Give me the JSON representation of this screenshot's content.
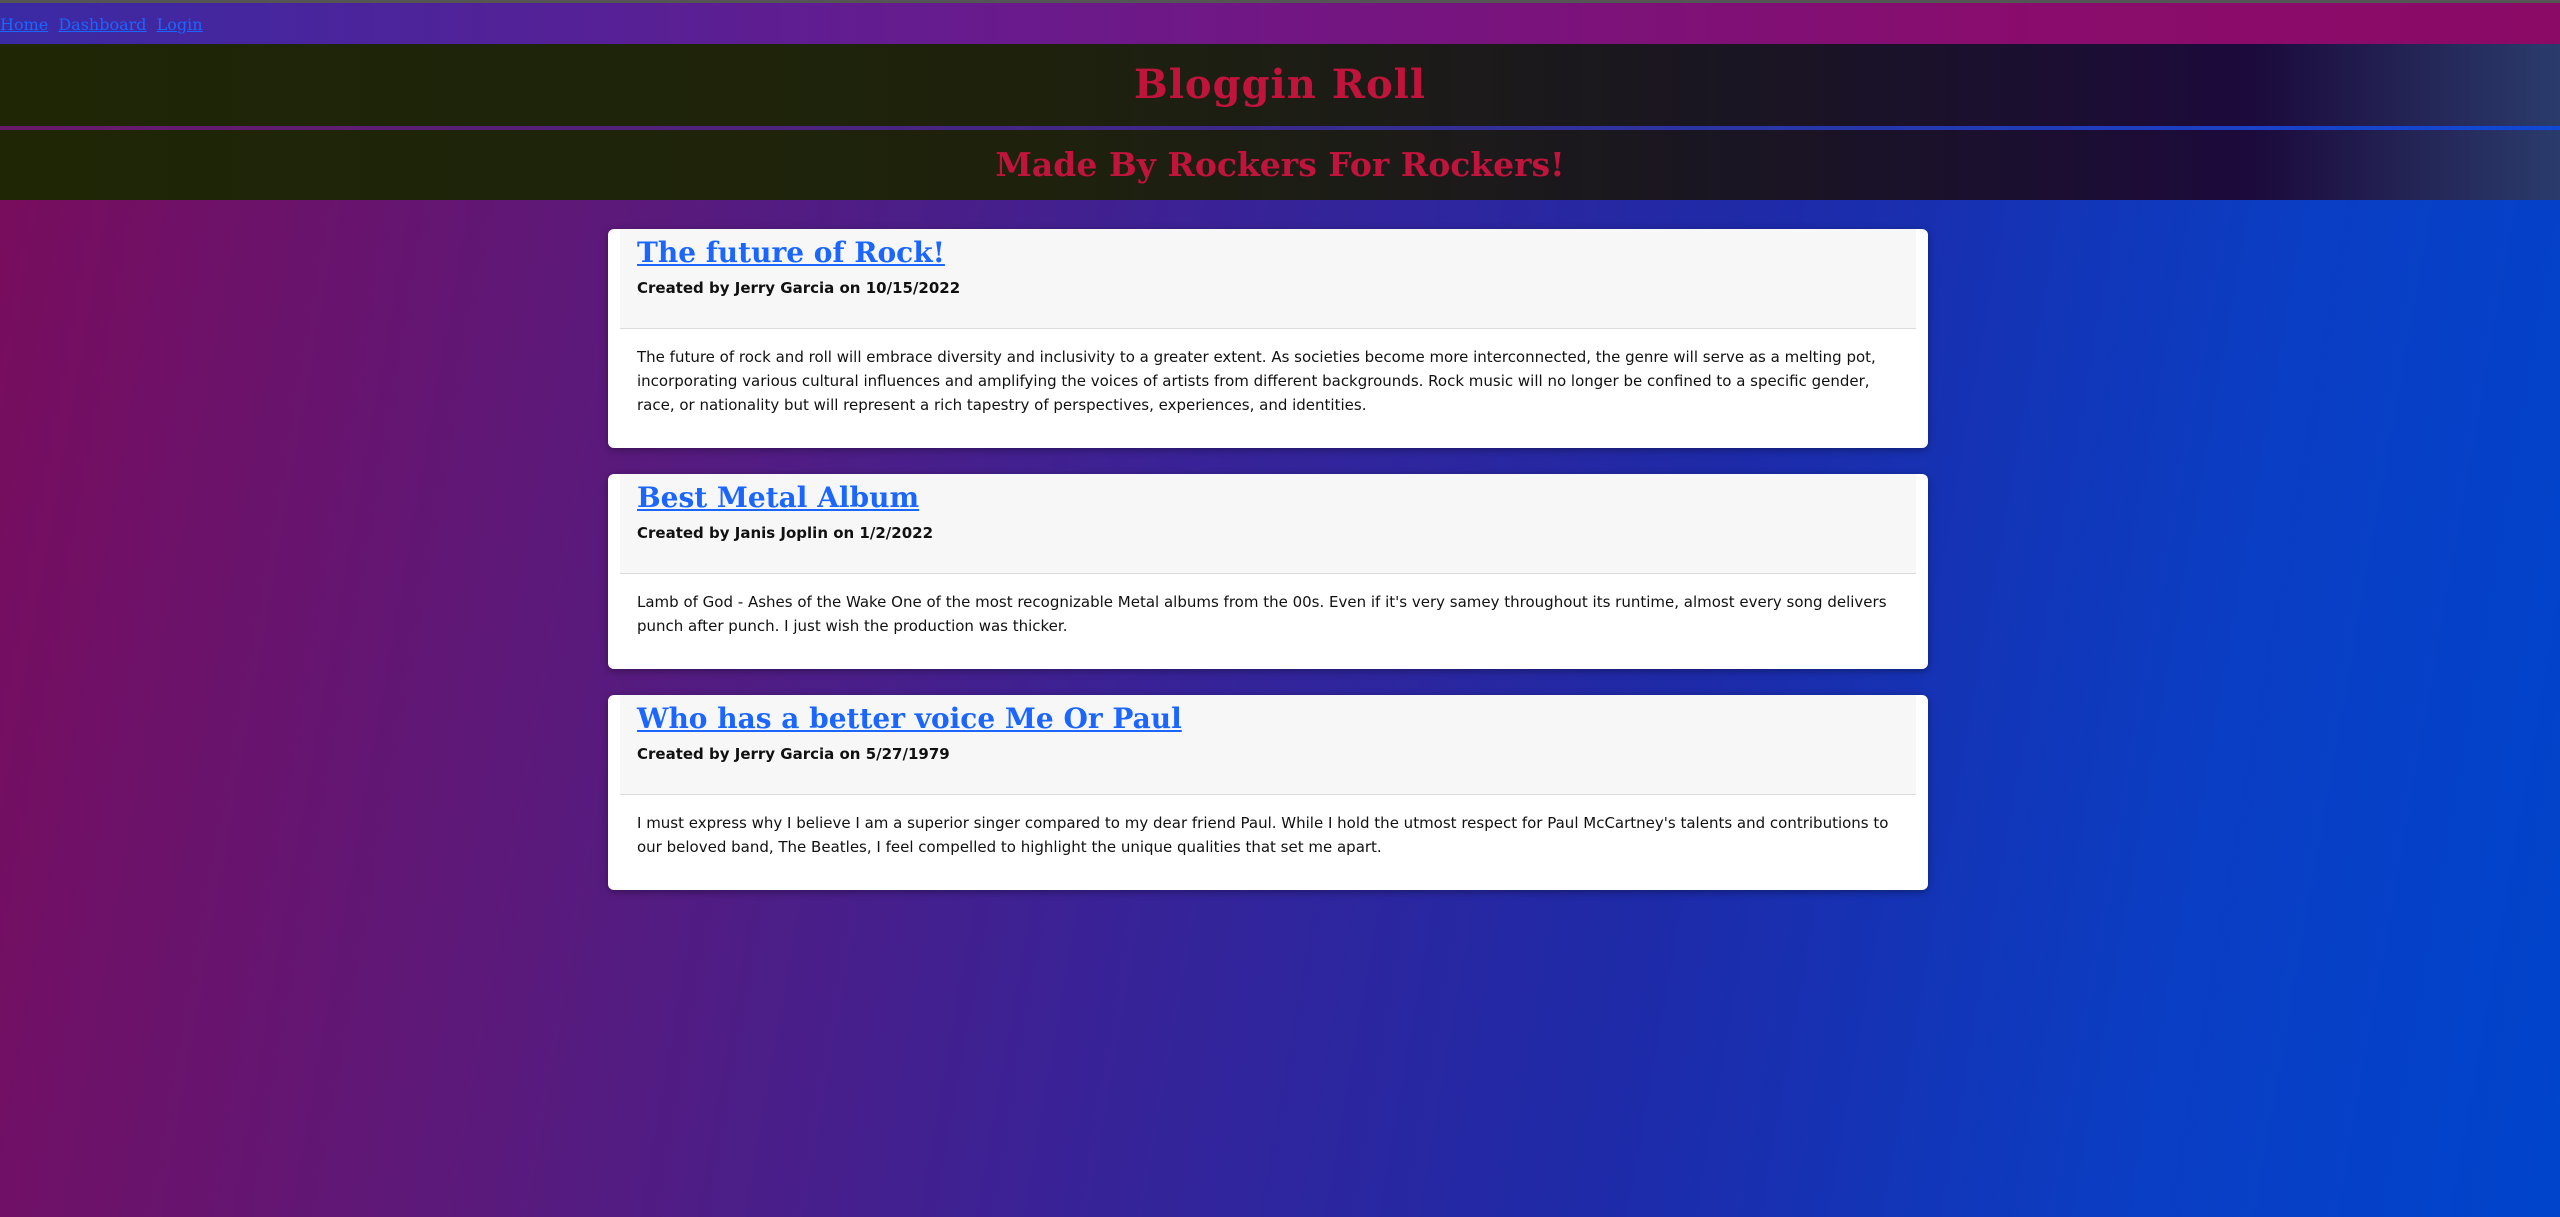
{
  "nav": {
    "home": "Home",
    "dashboard": "Dashboard",
    "login": "Login"
  },
  "header": {
    "title": "Bloggin Roll",
    "subtitle": "Made By Rockers For Rockers!"
  },
  "posts": [
    {
      "title": "The future of Rock!",
      "meta": "Created by Jerry Garcia on 10/15/2022",
      "body": "The future of rock and roll will embrace diversity and inclusivity to a greater extent. As societies become more interconnected, the genre will serve as a melting pot, incorporating various cultural influences and amplifying the voices of artists from different backgrounds. Rock music will no longer be confined to a specific gender, race, or nationality but will represent a rich tapestry of perspectives, experiences, and identities."
    },
    {
      "title": "Best Metal Album",
      "meta": "Created by Janis Joplin on 1/2/2022",
      "body": "Lamb of God - Ashes of the Wake One of the most recognizable Metal albums from the 00s. Even if it's very samey throughout its runtime, almost every song delivers punch after punch. I just wish the production was thicker."
    },
    {
      "title": "Who has a better voice Me Or Paul",
      "meta": "Created by Jerry Garcia on 5/27/1979",
      "body": "I must express why I believe I am a superior singer compared to my dear friend Paul. While I hold the utmost respect for Paul McCartney's talents and contributions to our beloved band, The Beatles, I feel compelled to highlight the unique qualities that set me apart."
    }
  ]
}
